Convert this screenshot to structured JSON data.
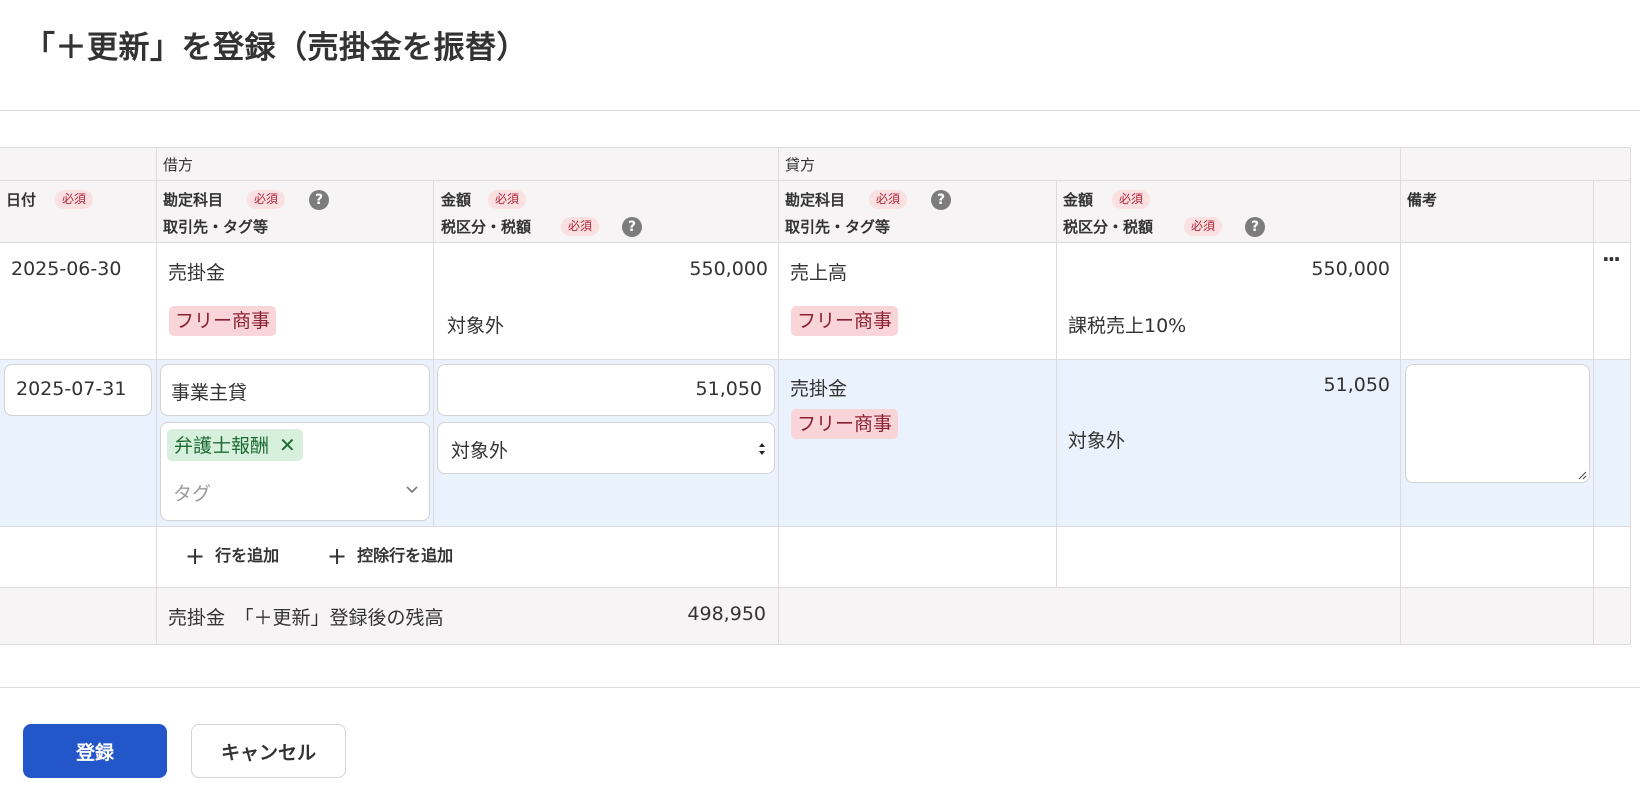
{
  "page": {
    "title": "「＋更新」を登録（売掛金を振替）"
  },
  "table": {
    "group_headers": {
      "debit": "借方",
      "credit": "貸方"
    },
    "headers": {
      "date": "日付",
      "debit_account": "勘定科目",
      "debit_partner": "取引先・タグ等",
      "debit_amount": "金額",
      "debit_tax": "税区分・税額",
      "credit_account": "勘定科目",
      "credit_partner": "取引先・タグ等",
      "credit_amount": "金額",
      "credit_tax": "税区分・税額",
      "memo": "備考"
    },
    "required_badge": "必須",
    "help_icon": "?",
    "rows": [
      {
        "date": "2025-06-30",
        "debit_account": "売掛金",
        "debit_amount": "550,000",
        "debit_partner": "フリー商事",
        "debit_tax": "対象外",
        "credit_account": "売上高",
        "credit_amount": "550,000",
        "credit_partner": "フリー商事",
        "credit_tax": "課税売上10%",
        "menu_icon": "···"
      },
      {
        "date": "2025-07-31",
        "debit_account": "事業主貸",
        "debit_amount": "51,050",
        "debit_tag": "弁護士報酬",
        "debit_tag_remove": "✕",
        "tag_placeholder": "タグ",
        "debit_tax": "対象外",
        "credit_account": "売掛金",
        "credit_partner": "フリー商事",
        "credit_amount": "51,050",
        "credit_tax": "対象外",
        "memo": ""
      }
    ],
    "actions": {
      "add_row": "行を追加",
      "add_deduction_row": "控除行を追加"
    },
    "footer": {
      "label": "売掛金　「＋更新」登録後の残高",
      "value": "498,950"
    }
  },
  "buttons": {
    "submit": "登録",
    "cancel": "キャンセル"
  },
  "colors": {
    "primary": "#2356c9",
    "required_bg": "#fbe0e2",
    "partner_tag_bg": "#f9d4d8",
    "green_tag_bg": "#d6f0dc",
    "selected_row_bg": "#eaf2fd",
    "header_bg": "#f6f4f4"
  },
  "icons": [
    "help-icon",
    "more-menu-icon",
    "remove-tag-icon",
    "chevron-down-icon",
    "select-arrows-icon",
    "plus-icon",
    "resize-handle-icon"
  ]
}
